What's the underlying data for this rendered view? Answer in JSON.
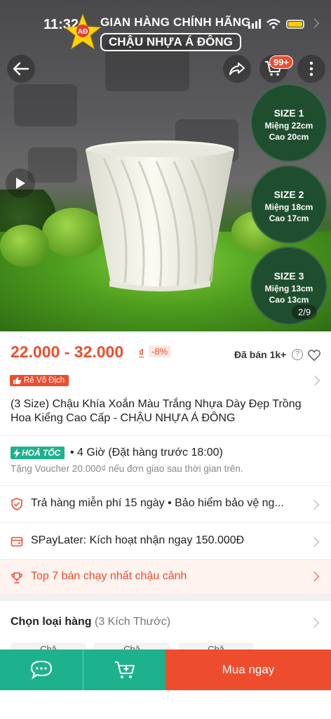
{
  "status_bar": {
    "time": "11:32"
  },
  "banner": {
    "logo_text": "AĐ",
    "line1": "GIAN HÀNG CHÍNH HÃNG",
    "line2": "CHẬU NHỰA Á ĐÔNG"
  },
  "header": {
    "cart_badge": "99+"
  },
  "sizes": [
    {
      "title": "SIZE 1",
      "mouth": "Miệng 22cm",
      "height": "Cao 20cm"
    },
    {
      "title": "SIZE 2",
      "mouth": "Miệng 18cm",
      "height": "Cao 17cm"
    },
    {
      "title": "SIZE 3",
      "mouth": "Miệng 13cm",
      "height": "Cao 13cm"
    }
  ],
  "gallery": {
    "counter": "2/9"
  },
  "product": {
    "price_range": "22.000 - 32.000",
    "currency": "₫",
    "discount": "-8%",
    "sold": "Đã bán 1k+",
    "badge": "Rẻ Vô Địch",
    "title": "(3 Size) Chậu Khía Xoắn Màu Trắng Nhựa Dày Đẹp Trồng Hoa Kiểng Cao Cấp - CHẬU NHỰA Á ĐÔNG"
  },
  "shipping": {
    "badge": "HOẢ TỐC",
    "time": "• 4 Giờ (Đặt hàng trước 18:00)",
    "voucher_note": "Tặng Voucher 20.000₫ nếu đơn giao sau thời gian trên."
  },
  "rows": {
    "return": "Trả hàng miễn phí 15 ngày  •  Bảo hiểm bảo vệ ng...",
    "spaylater": "SPayLater: Kích hoạt nhận ngay 150.000Đ",
    "top": "Top 7 bán chạy nhất chậu cảnh"
  },
  "variants": {
    "title": "Chọn loại hàng",
    "count": "(3 Kích Thước)",
    "chips": [
      "Chậ",
      "Chậ",
      "Chậ"
    ]
  },
  "bottom_bar": {
    "buy_now": "Mua ngay"
  },
  "colors": {
    "primary": "#ee4d2d",
    "teal": "#1db28d",
    "size_circle": "#1f4e2f"
  }
}
